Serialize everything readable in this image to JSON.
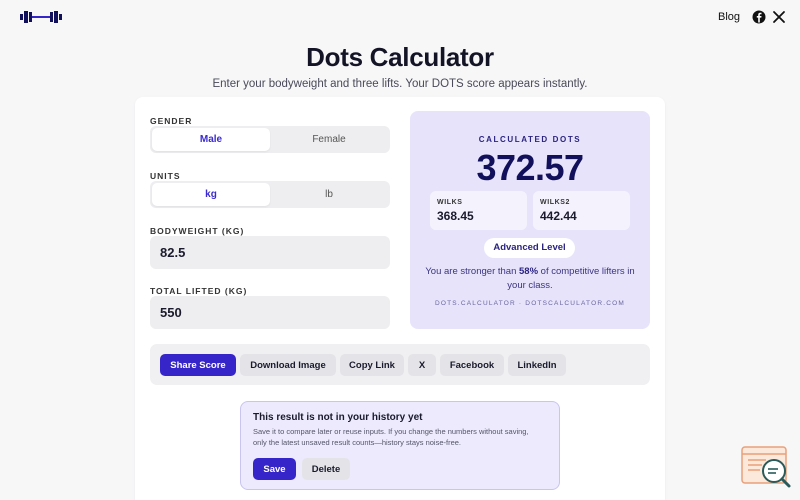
{
  "nav": {
    "logo_icon": "barbell-logo",
    "blog_label": "Blog",
    "social_icons": [
      "facebook-icon",
      "x-icon"
    ]
  },
  "header": {
    "title": "Dots Calculator",
    "subtitle": "Enter your bodyweight and three lifts. Your DOTS score appears instantly."
  },
  "form": {
    "gender": {
      "label": "GENDER",
      "options": [
        "Male",
        "Female"
      ],
      "selected": "Male"
    },
    "units": {
      "label": "UNITS",
      "options": [
        "kg",
        "lb"
      ],
      "selected": "kg"
    },
    "bodyweight": {
      "label": "BODYWEIGHT (KG)",
      "value": "82.5"
    },
    "total": {
      "label": "TOTAL LIFTED (KG)",
      "value": "550"
    }
  },
  "result": {
    "label": "CALCULATED DOTS",
    "score": "372.57",
    "wilks_label": "WILKS",
    "wilks_value": "368.45",
    "wilks2_label": "WILKS2",
    "wilks2_value": "442.44",
    "level": "Advanced Level",
    "desc_prefix": "You are stronger than ",
    "desc_percent": "58%",
    "desc_suffix": " of competitive lifters in your class.",
    "footer": "DOTS.CALCULATOR · DOTSCALCULATOR.COM"
  },
  "share": {
    "buttons": [
      "Share Score",
      "Download Image",
      "Copy Link",
      "X",
      "Facebook",
      "LinkedIn"
    ]
  },
  "history": {
    "title": "This result is not in your history yet",
    "body": "Save it to compare later or reuse inputs. If you change the numbers without saving, only the latest unsaved result counts—history stays noise-free.",
    "save_label": "Save",
    "delete_label": "Delete"
  },
  "colors": {
    "accent": "#3625c9",
    "result_bg": "#e6e3fb",
    "score_text": "#12105a"
  }
}
